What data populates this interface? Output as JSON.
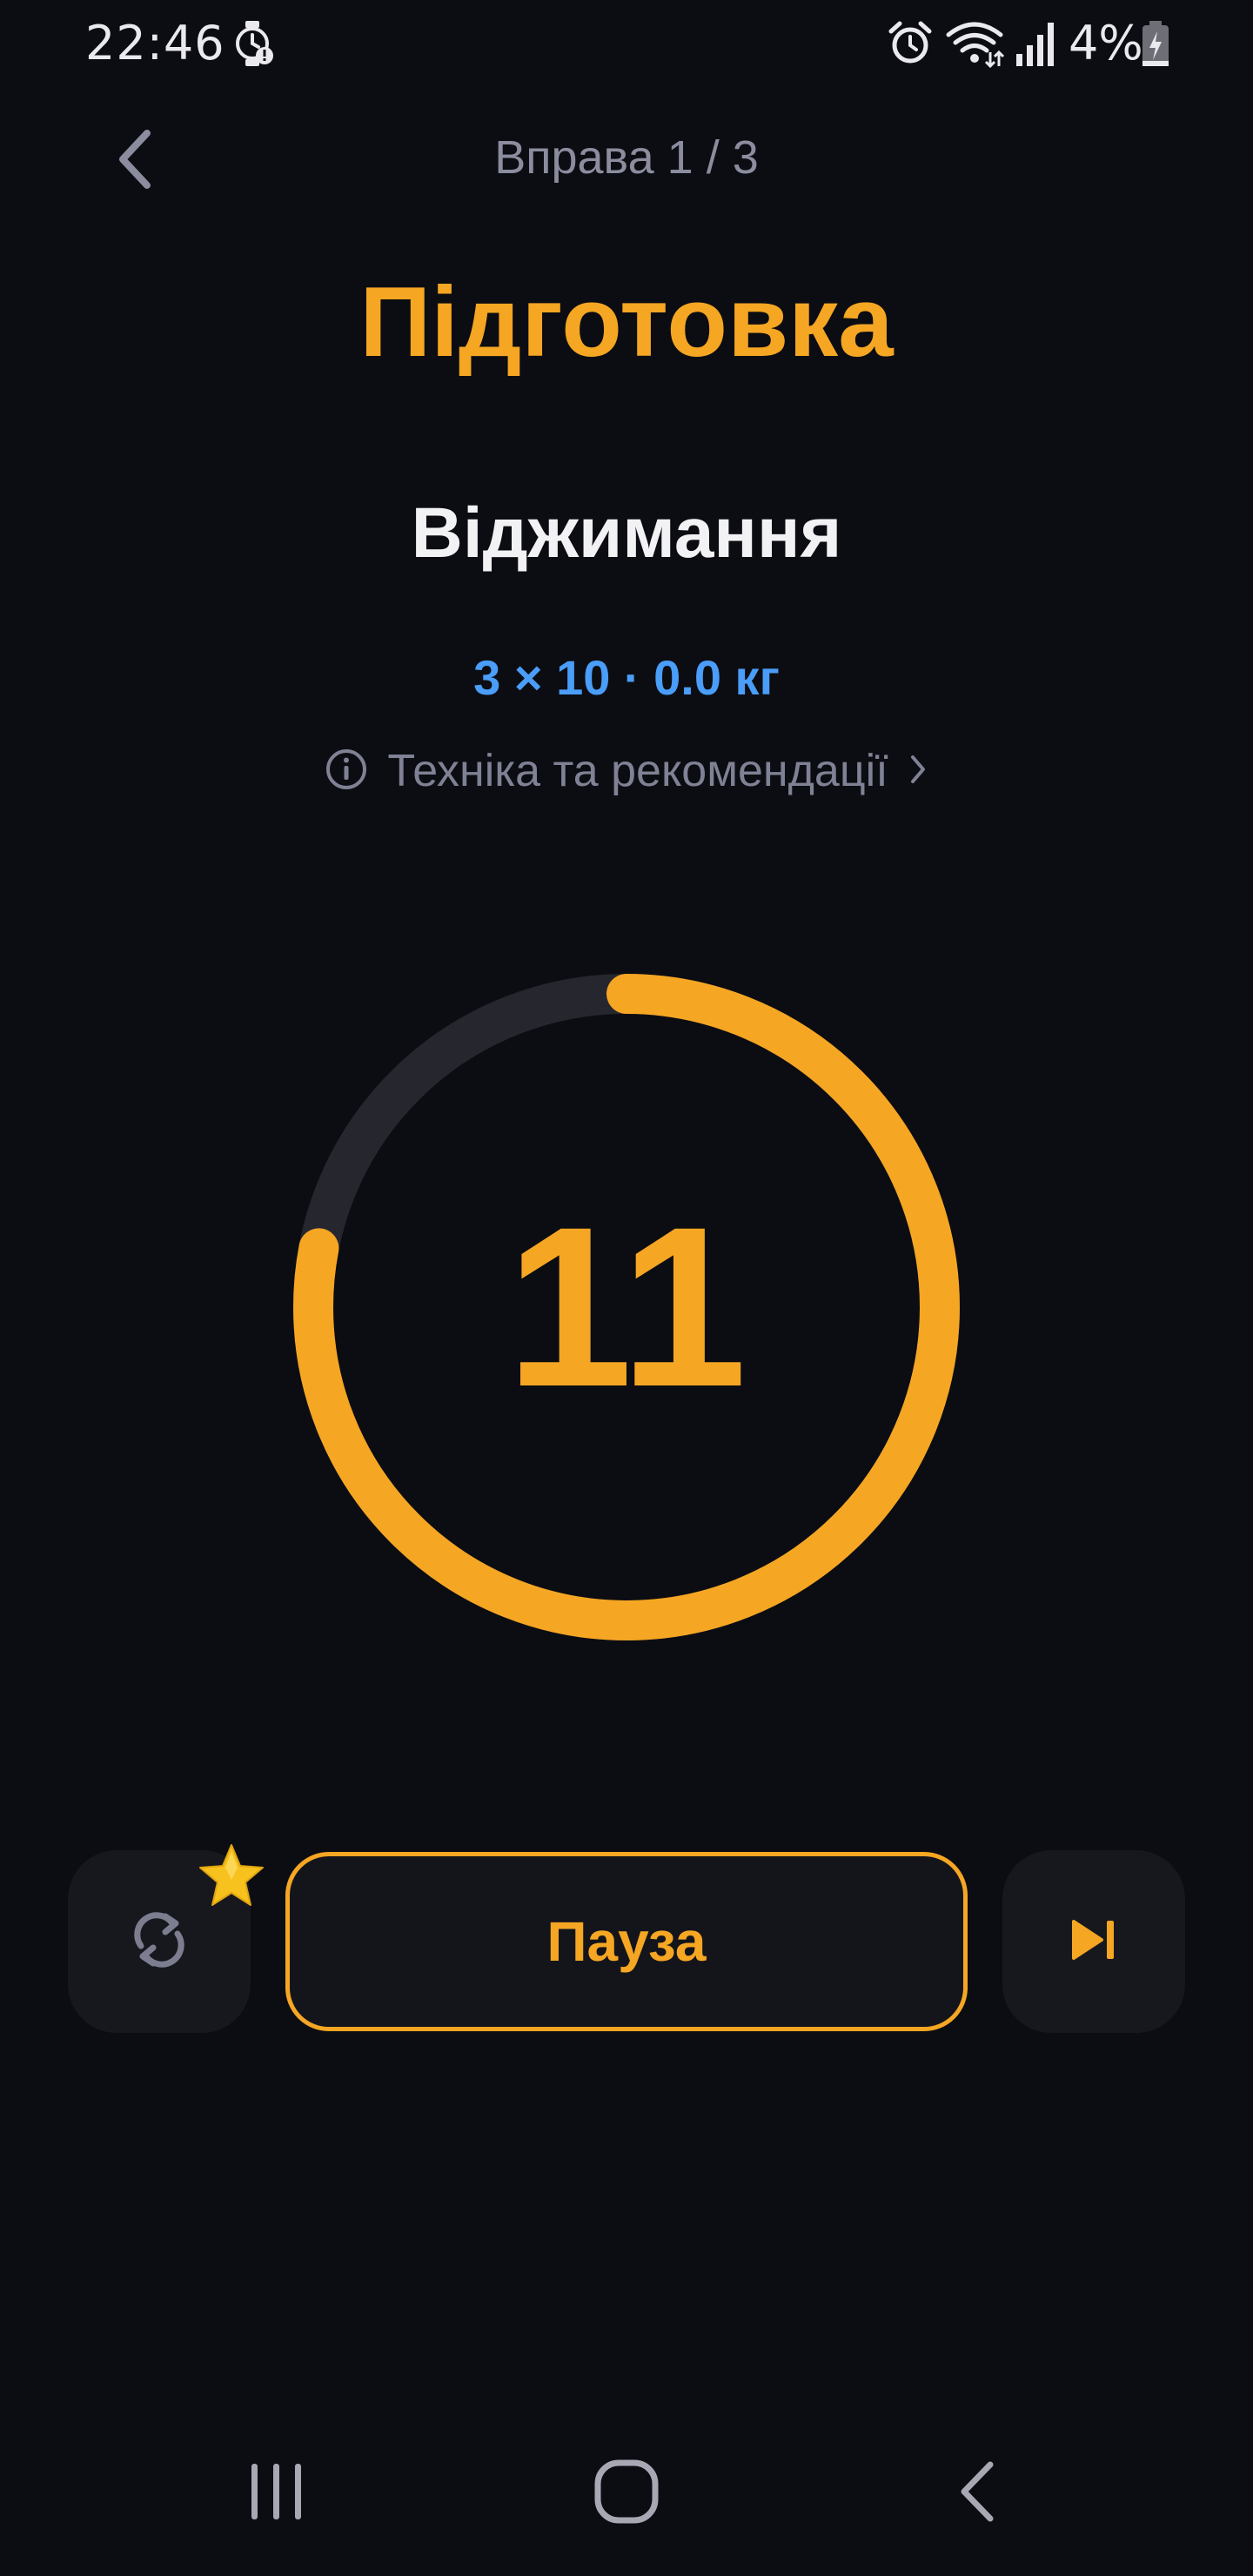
{
  "status_bar": {
    "time": "22:46",
    "battery_percent": "4%",
    "icons": [
      "watch-alert-icon",
      "alarm-icon",
      "wifi-icon",
      "signal-icon",
      "battery-charging-icon"
    ]
  },
  "header": {
    "title": "Вправа 1 / 3",
    "back_icon": "chevron-left-icon"
  },
  "phase_title": "Підготовка",
  "exercise": {
    "name": "Віджимання",
    "plan": "3 × 10 · 0.0 кг",
    "technique_label": "Техніка та рекомендації"
  },
  "timer": {
    "value": "11",
    "progress_fraction": 0.78
  },
  "controls": {
    "restart_icon": "repeat-icon",
    "premium_badge_icon": "star-icon",
    "pause_label": "Пауза",
    "skip_icon": "skip-next-icon"
  },
  "nav_bar": {
    "items": [
      "recent-apps-icon",
      "home-icon",
      "back-icon"
    ]
  },
  "colors": {
    "background": "#0c0d12",
    "accent": "#f5a623",
    "plan_blue": "#4a9df8",
    "muted_text": "#8b8d9f",
    "track": "#26262f",
    "button_bg": "#17181e"
  }
}
